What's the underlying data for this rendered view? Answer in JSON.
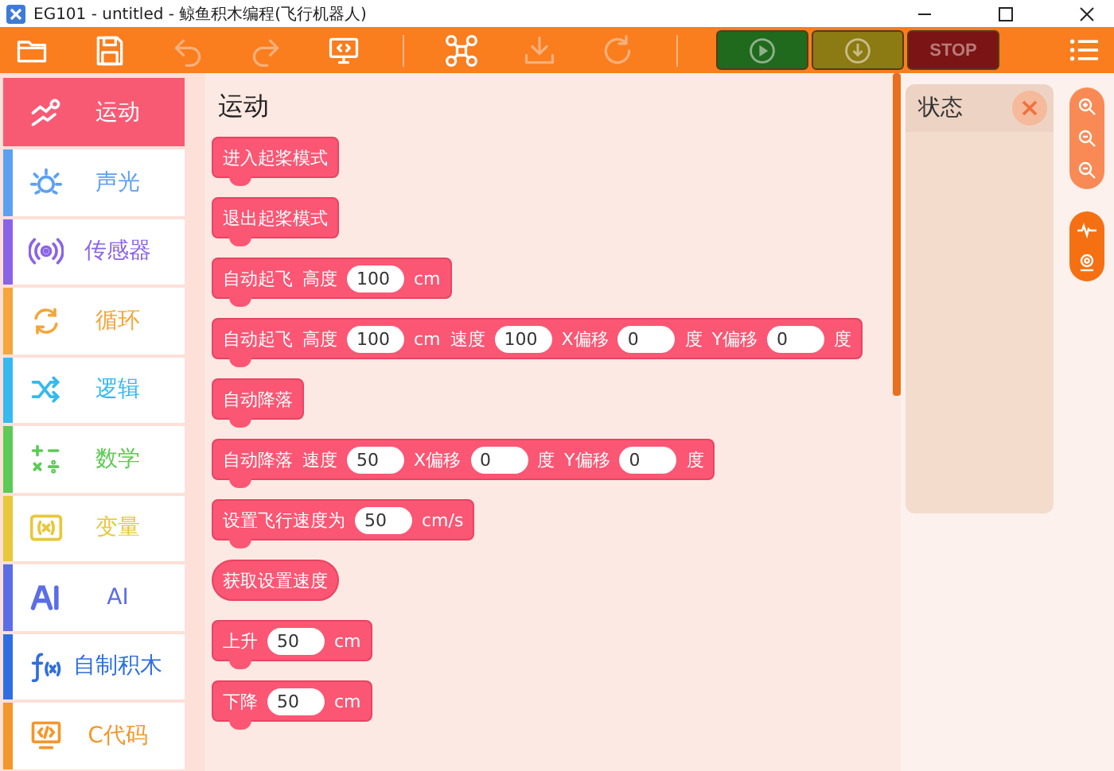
{
  "window": {
    "title": "EG101 - untitled  - 鲸鱼积木编程(飞行机器人)"
  },
  "toolbar": {
    "tools": [
      {
        "disabled": false
      },
      {
        "disabled": false
      },
      {
        "disabled": true
      },
      {
        "disabled": true
      },
      {
        "disabled": false
      },
      {
        "disabled": false
      },
      {
        "disabled": true
      },
      {
        "disabled": true
      }
    ],
    "actions": [
      {
        "kind": "run",
        "color": "#1f6a1c"
      },
      {
        "kind": "upload",
        "color": "#8c7a12"
      },
      {
        "kind": "stop",
        "color": "#7b1414",
        "label": "STOP"
      }
    ]
  },
  "sidebar": {
    "items": [
      {
        "label": "运动",
        "color": "#f85a74",
        "selected": true
      },
      {
        "label": "声光",
        "color": "#5ca0f2",
        "selected": false
      },
      {
        "label": "传感器",
        "color": "#8a63e8",
        "selected": false
      },
      {
        "label": "循环",
        "color": "#f5a53a",
        "selected": false
      },
      {
        "label": "逻辑",
        "color": "#36b9ee",
        "selected": false
      },
      {
        "label": "数学",
        "color": "#5ccb55",
        "selected": false
      },
      {
        "label": "变量",
        "color": "#e8c73a",
        "selected": false
      },
      {
        "label": "AI",
        "color": "#5b6ee8",
        "selected": false
      },
      {
        "label": "自制积木",
        "color": "#2f6ee0",
        "selected": false
      },
      {
        "label": "C代码",
        "color": "#f5962a",
        "selected": false
      }
    ]
  },
  "flyout": {
    "title": "运动",
    "blocks": [
      {
        "kind": "statement",
        "parts": [
          {
            "kind": "text",
            "text": "进入起桨模式"
          }
        ]
      },
      {
        "kind": "statement",
        "parts": [
          {
            "kind": "text",
            "text": "退出起桨模式"
          }
        ]
      },
      {
        "kind": "statement",
        "parts": [
          {
            "kind": "text",
            "text": "自动起飞"
          },
          {
            "kind": "text",
            "text": "高度"
          },
          {
            "kind": "input",
            "text": "100"
          },
          {
            "kind": "text",
            "text": "cm"
          }
        ]
      },
      {
        "kind": "statement",
        "parts": [
          {
            "kind": "text",
            "text": "自动起飞"
          },
          {
            "kind": "text",
            "text": "高度"
          },
          {
            "kind": "input",
            "text": "100"
          },
          {
            "kind": "text",
            "text": "cm"
          },
          {
            "kind": "text",
            "text": "速度"
          },
          {
            "kind": "input",
            "text": "100"
          },
          {
            "kind": "text",
            "text": "X偏移"
          },
          {
            "kind": "input",
            "text": "0"
          },
          {
            "kind": "text",
            "text": "度"
          },
          {
            "kind": "text",
            "text": "Y偏移"
          },
          {
            "kind": "input",
            "text": "0"
          },
          {
            "kind": "text",
            "text": "度"
          }
        ]
      },
      {
        "kind": "statement",
        "parts": [
          {
            "kind": "text",
            "text": "自动降落"
          }
        ]
      },
      {
        "kind": "statement",
        "parts": [
          {
            "kind": "text",
            "text": "自动降落"
          },
          {
            "kind": "text",
            "text": "速度"
          },
          {
            "kind": "input",
            "text": "50"
          },
          {
            "kind": "text",
            "text": "X偏移"
          },
          {
            "kind": "input",
            "text": "0"
          },
          {
            "kind": "text",
            "text": "度"
          },
          {
            "kind": "text",
            "text": "Y偏移"
          },
          {
            "kind": "input",
            "text": "0"
          },
          {
            "kind": "text",
            "text": "度"
          }
        ]
      },
      {
        "kind": "statement",
        "parts": [
          {
            "kind": "text",
            "text": "设置飞行速度为"
          },
          {
            "kind": "input",
            "text": "50"
          },
          {
            "kind": "text",
            "text": "cm/s"
          }
        ]
      },
      {
        "kind": "reporter",
        "parts": [
          {
            "kind": "text",
            "text": "获取设置速度"
          }
        ]
      },
      {
        "kind": "statement",
        "parts": [
          {
            "kind": "text",
            "text": "上升"
          },
          {
            "kind": "input",
            "text": "50"
          },
          {
            "kind": "text",
            "text": "cm"
          }
        ]
      },
      {
        "kind": "statement",
        "parts": [
          {
            "kind": "text",
            "text": "下降"
          },
          {
            "kind": "input",
            "text": "50"
          },
          {
            "kind": "text",
            "text": "cm"
          }
        ]
      }
    ]
  },
  "status_panel": {
    "title": "状态"
  }
}
